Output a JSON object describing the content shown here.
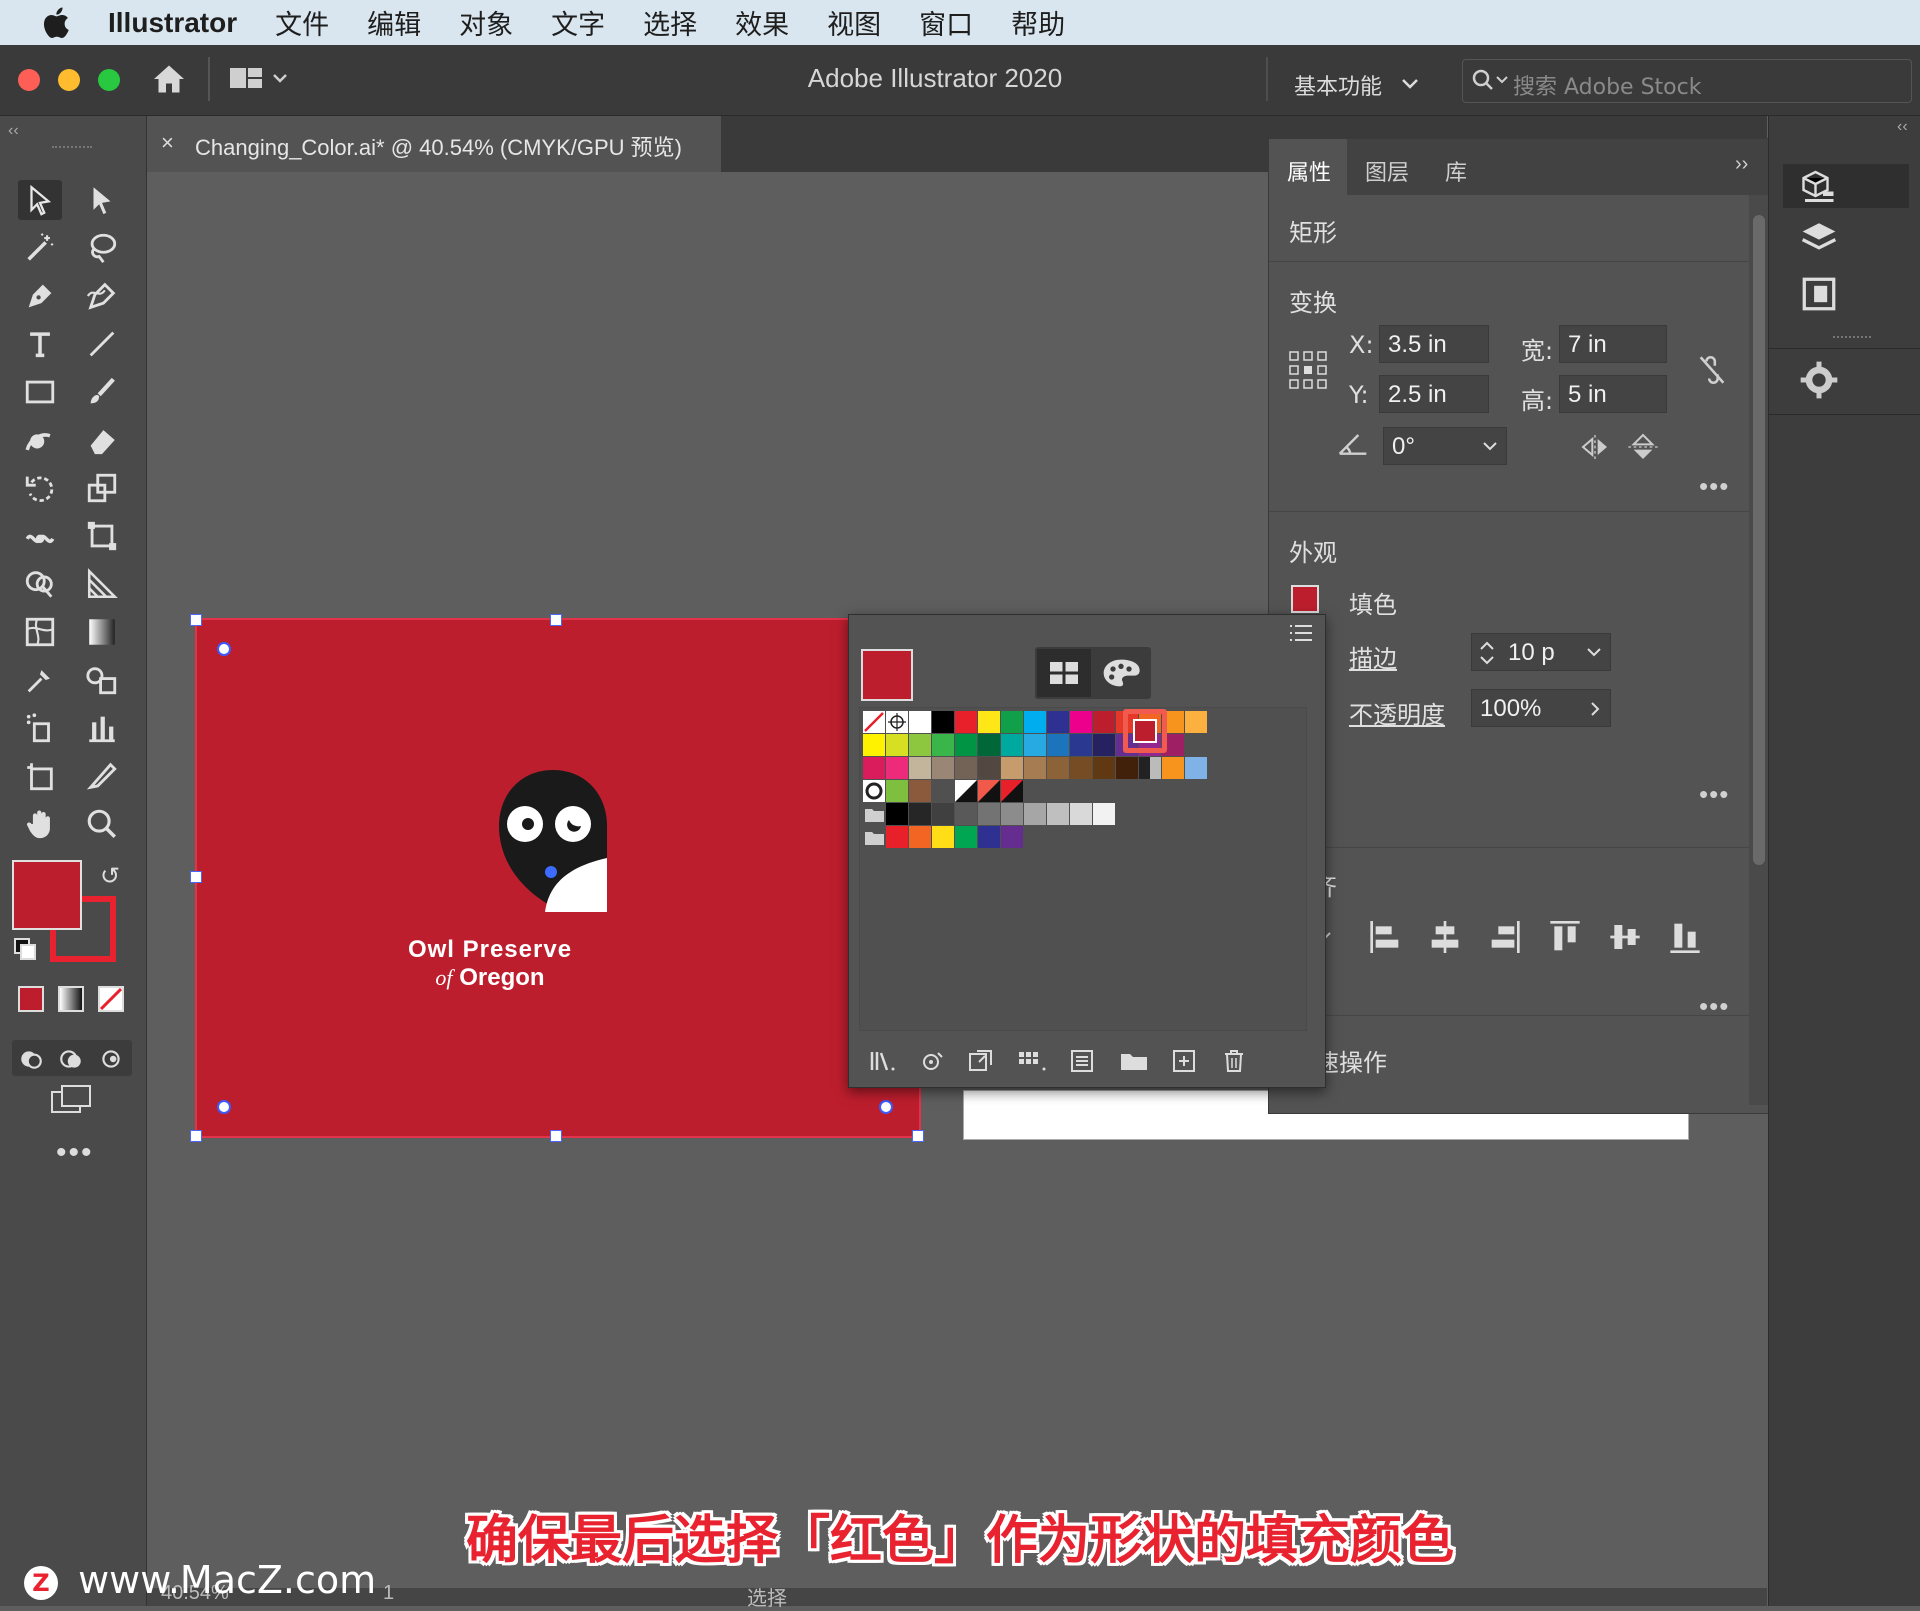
{
  "menubar": {
    "app_name": "Illustrator",
    "items": [
      "文件",
      "编辑",
      "对象",
      "文字",
      "选择",
      "效果",
      "视图",
      "窗口",
      "帮助"
    ]
  },
  "titlebar": {
    "app_title": "Adobe Illustrator 2020",
    "workspace": "基本功能",
    "search_placeholder": "搜索 Adobe Stock"
  },
  "document": {
    "tab_title": "Changing_Color.ai* @ 40.54% (CMYK/GPU 预览)",
    "logo_line1": "Owl Preserve",
    "logo_of": "of",
    "logo_line2": "Oregon"
  },
  "properties_panel": {
    "tabs": [
      "属性",
      "图层",
      "库"
    ],
    "object_type": "矩形",
    "transform": {
      "heading": "变换",
      "x_label": "X:",
      "x_value": "3.5 in",
      "y_label": "Y:",
      "y_value": "2.5 in",
      "w_label": "宽:",
      "w_value": "7 in",
      "h_label": "高:",
      "h_value": "5 in",
      "angle_value": "0°"
    },
    "appearance": {
      "heading": "外观",
      "fill_label": "填色",
      "stroke_label": "描边",
      "stroke_value": "10 p",
      "opacity_label": "不透明度",
      "opacity_value": "100%"
    },
    "align_heading_fragment": "齐",
    "quick_actions_fragment": "速操作"
  },
  "colors": {
    "fill": "#bd1e2d",
    "accent_highlight": "#f05a4f"
  },
  "status": {
    "zoom": "40.54%",
    "page": "1",
    "tool_name": "选择"
  },
  "caption": "确保最后选择「红色」作为形状的填充颜色",
  "watermark": "www.MacZ.com"
}
